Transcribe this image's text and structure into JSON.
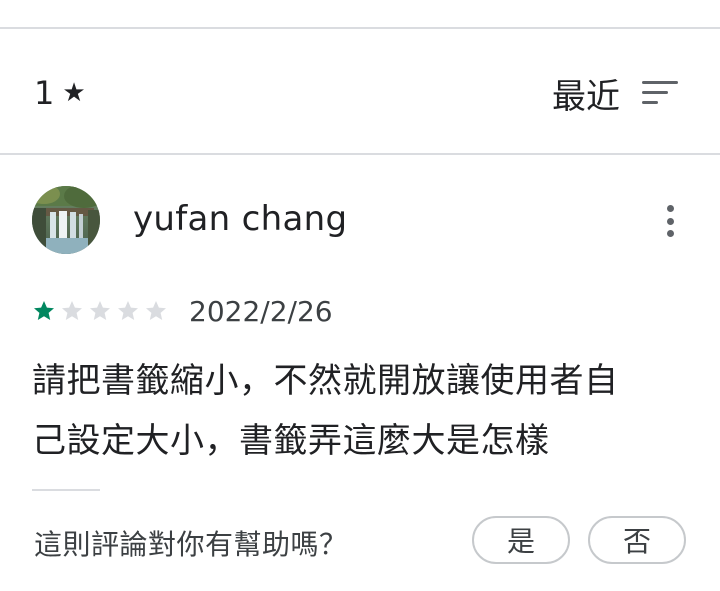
{
  "filter_bar": {
    "rating_value": "1",
    "rating_star": "★",
    "sort_label": "最近",
    "sort_icon": "sort-icon"
  },
  "review": {
    "reviewer_name": "yufan chang",
    "avatar": "waterfall-photo",
    "rating": 1,
    "max_rating": 5,
    "date": "2022/2/26",
    "text_line_1": "請把書籤縮小，不然就開放讓使用者自",
    "text_line_2": "己設定大小，書籤弄這麼大是怎樣",
    "helpful_prompt": "這則評論對你有幫助嗎？",
    "yes_label": "是",
    "no_label": "否"
  },
  "colors": {
    "star_filled": "#01875f",
    "star_empty": "#dadce0",
    "divider": "#dadce0"
  }
}
